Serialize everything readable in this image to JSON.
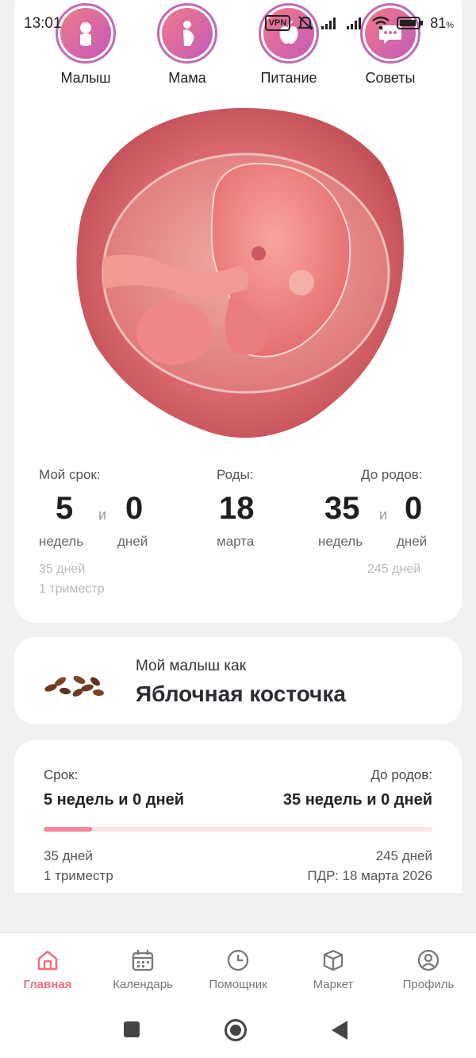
{
  "status": {
    "time": "13:01",
    "vpn": "VPN",
    "battery": "81",
    "battery_unit": "%"
  },
  "categories": [
    {
      "label": "Малыш",
      "icon": "baby-icon"
    },
    {
      "label": "Мама",
      "icon": "pregnant-icon"
    },
    {
      "label": "Питание",
      "icon": "apple-icon"
    },
    {
      "label": "Советы",
      "icon": "chat-icon"
    }
  ],
  "term": {
    "my_term_label": "Мой срок:",
    "weeks": "5",
    "and": "и",
    "days": "0",
    "weeks_unit": "недель",
    "days_unit": "дней",
    "days_total": "35 дней",
    "trimester": "1 триместр"
  },
  "birth": {
    "label": "Роды:",
    "day": "18",
    "month": "марта"
  },
  "until": {
    "label": "До родов:",
    "weeks": "35",
    "and": "и",
    "days": "0",
    "weeks_unit": "недель",
    "days_unit": "дней",
    "days_total": "245 дней"
  },
  "fruit": {
    "subtitle": "Мой малыш как",
    "title": "Яблочная косточка"
  },
  "progress": {
    "term_label": "Срок:",
    "term_value": "5 недель и 0 дней",
    "until_label": "До родов:",
    "until_value": "35 недель и 0 дней",
    "fraction": 0.125,
    "days_passed": "35 дней",
    "trimester": "1 триместр",
    "days_left": "245 дней",
    "due_date": "ПДР: 18 марта 2026"
  },
  "nav": [
    {
      "label": "Главная",
      "icon": "home-icon",
      "active": true
    },
    {
      "label": "Календарь",
      "icon": "calendar-icon",
      "active": false
    },
    {
      "label": "Помощник",
      "icon": "clock-icon",
      "active": false
    },
    {
      "label": "Маркет",
      "icon": "box-icon",
      "active": false
    },
    {
      "label": "Профиль",
      "icon": "profile-icon",
      "active": false
    }
  ],
  "colors": {
    "accent": "#ef6f7f",
    "progress_fill": "#f4899a",
    "progress_track": "#fde3e6"
  }
}
